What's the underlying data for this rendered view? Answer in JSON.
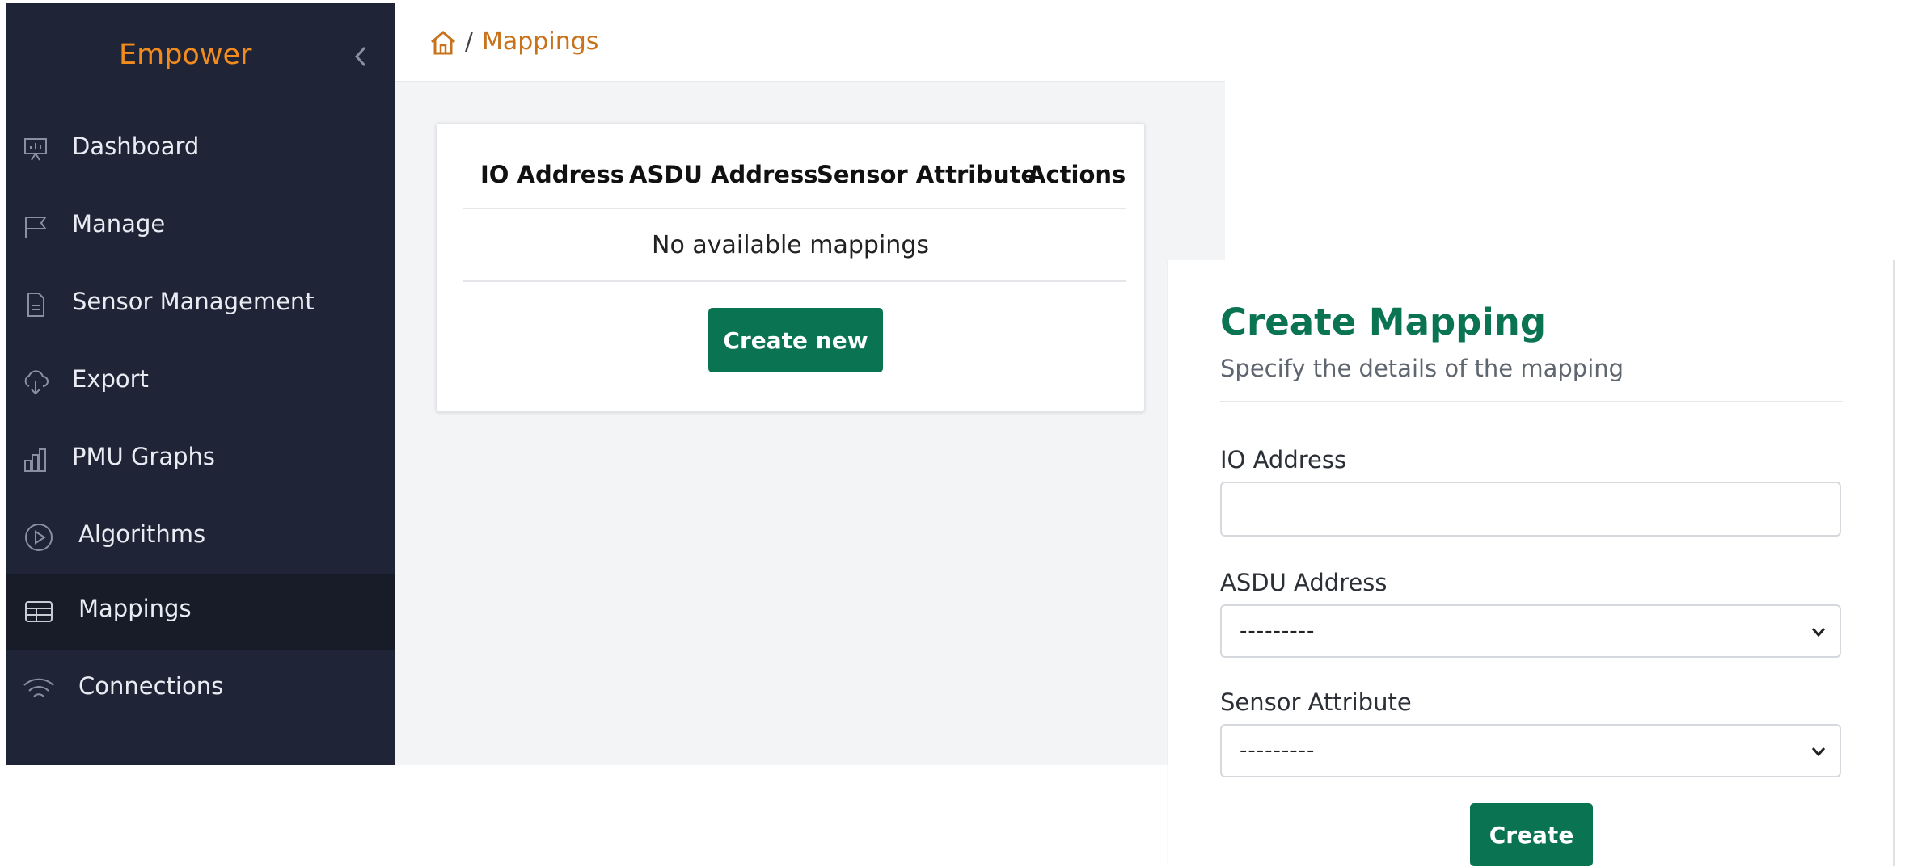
{
  "sidebar": {
    "brand": "Empower",
    "items": [
      {
        "label": "Dashboard",
        "icon": "presentation-chart-icon",
        "active": false
      },
      {
        "label": "Manage",
        "icon": "flag-icon",
        "active": false
      },
      {
        "label": "Sensor Management",
        "icon": "document-icon",
        "active": false
      },
      {
        "label": "Export",
        "icon": "cloud-download-icon",
        "active": false
      },
      {
        "label": "PMU Graphs",
        "icon": "bar-chart-icon",
        "active": false
      },
      {
        "label": "Algorithms",
        "icon": "play-circle-icon",
        "active": false
      },
      {
        "label": "Mappings",
        "icon": "table-icon",
        "active": true
      },
      {
        "label": "Connections",
        "icon": "wifi-icon",
        "active": false
      }
    ]
  },
  "breadcrumb": {
    "separator": "/",
    "current": "Mappings"
  },
  "table": {
    "columns": [
      "IO Address",
      "ASDU Address",
      "Sensor Attribute",
      "Actions"
    ],
    "empty_message": "No available mappings",
    "create_button": "Create new"
  },
  "panel": {
    "title": "Create Mapping",
    "subtitle": "Specify the details of the mapping",
    "fields": {
      "io_address": {
        "label": "IO Address",
        "value": ""
      },
      "asdu_address": {
        "label": "ASDU Address",
        "selected": "---------"
      },
      "sensor_attribute": {
        "label": "Sensor Attribute",
        "selected": "---------"
      }
    },
    "submit": "Create"
  },
  "colors": {
    "sidebar_bg": "#1f2536",
    "brand": "#f28c1e",
    "accent_green": "#0a7352",
    "breadcrumb": "#c8731b"
  }
}
